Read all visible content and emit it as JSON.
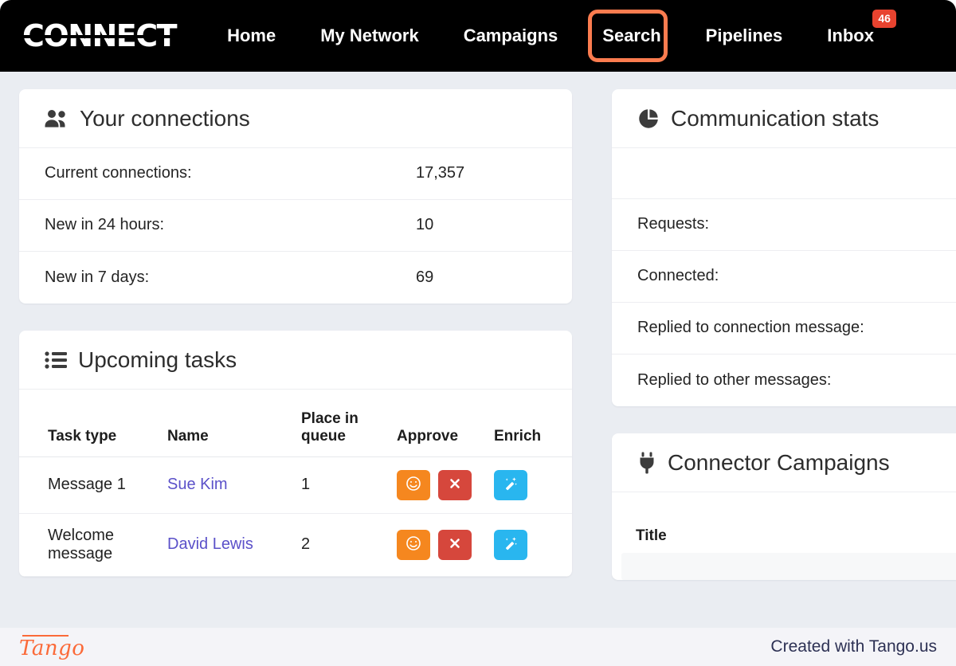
{
  "navbar": {
    "logo_text": "CONNECT",
    "items": [
      {
        "label": "Home",
        "name": "nav-item-home"
      },
      {
        "label": "My Network",
        "name": "nav-item-my-network"
      },
      {
        "label": "Campaigns",
        "name": "nav-item-campaigns"
      },
      {
        "label": "Search",
        "name": "nav-item-search"
      },
      {
        "label": "Pipelines",
        "name": "nav-item-pipelines"
      },
      {
        "label": "Inbox",
        "name": "nav-item-inbox"
      }
    ],
    "inbox_badge": "46",
    "highlight_color": "#fb7c4f",
    "badge_color": "#e8432f"
  },
  "connections_card": {
    "title": "Your connections",
    "icon": "users-icon",
    "rows": [
      {
        "label": "Current connections:",
        "value": "17,357"
      },
      {
        "label": "New in 24 hours:",
        "value": "10"
      },
      {
        "label": "New in 7 days:",
        "value": "69"
      }
    ]
  },
  "tasks_card": {
    "title": "Upcoming tasks",
    "icon": "list-icon",
    "columns": [
      "Task type",
      "Name",
      "Place in queue",
      "Approve",
      "Enrich"
    ],
    "rows": [
      {
        "task_type": "Message 1",
        "name": "Sue Kim",
        "place_in_queue": "1",
        "approve_icon": "smiley-icon",
        "reject_icon": "close-icon",
        "enrich_icon": "magic-wand-icon"
      },
      {
        "task_type": "Welcome message",
        "name": "David Lewis",
        "place_in_queue": "2",
        "approve_icon": "smiley-icon",
        "reject_icon": "close-icon",
        "enrich_icon": "magic-wand-icon"
      }
    ],
    "button_colors": {
      "approve": "#f5871f",
      "reject": "#d6473c",
      "enrich": "#29b6ef"
    },
    "link_color": "#5b51c9"
  },
  "communication_card": {
    "title": "Communication stats",
    "icon": "pie-chart-icon",
    "rows": [
      {
        "label": ""
      },
      {
        "label": "Requests:"
      },
      {
        "label": "Connected:"
      },
      {
        "label": "Replied to connection message:"
      },
      {
        "label": "Replied to other messages:"
      }
    ]
  },
  "campaigns_card": {
    "title": "Connector Campaigns",
    "icon": "plug-icon",
    "column_header": "Title"
  },
  "footer": {
    "logo_text": "Tango",
    "note": "Created with Tango.us",
    "accent_color": "#fb6a39"
  }
}
